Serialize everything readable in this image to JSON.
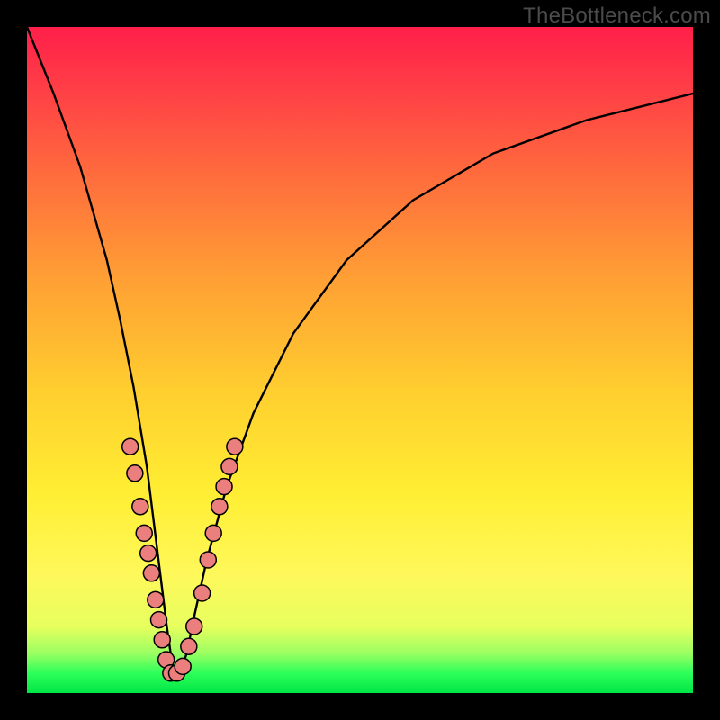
{
  "watermark": "TheBottleneck.com",
  "colors": {
    "frame": "#000000",
    "curve_stroke": "#000000",
    "marker_fill": "#eb7f7d",
    "marker_stroke": "#000000",
    "gradient_top": "#ff1f4a",
    "gradient_mid": "#ffee33",
    "gradient_bottom": "#00e646"
  },
  "chart_data": {
    "type": "line",
    "title": "",
    "xlabel": "",
    "ylabel": "",
    "xlim": [
      0,
      100
    ],
    "ylim": [
      0,
      100
    ],
    "grid": false,
    "legend": false,
    "note": "Axes are unlabeled; values are pixel-proportional estimates on a 0–100 scale in each direction (0,0 at bottom-left). Curve forms a V reaching ~0 near x≈22.",
    "series": [
      {
        "name": "bottleneck-curve",
        "x": [
          0,
          4,
          8,
          12,
          14,
          16,
          18,
          19,
          20,
          21,
          22,
          23,
          24,
          25,
          27,
          30,
          34,
          40,
          48,
          58,
          70,
          84,
          100
        ],
        "y": [
          100,
          90,
          79,
          65,
          56,
          46,
          34,
          26,
          18,
          10,
          3,
          3,
          6,
          11,
          20,
          31,
          42,
          54,
          65,
          74,
          81,
          86,
          90
        ]
      }
    ],
    "markers": {
      "name": "curve-markers",
      "note": "Pink circular markers clustered on both walls of the V near the bottom.",
      "points": [
        {
          "x": 15.5,
          "y": 37
        },
        {
          "x": 16.2,
          "y": 33
        },
        {
          "x": 17.0,
          "y": 28
        },
        {
          "x": 17.6,
          "y": 24
        },
        {
          "x": 18.2,
          "y": 21
        },
        {
          "x": 18.7,
          "y": 18
        },
        {
          "x": 19.3,
          "y": 14
        },
        {
          "x": 19.8,
          "y": 11
        },
        {
          "x": 20.3,
          "y": 8
        },
        {
          "x": 20.9,
          "y": 5
        },
        {
          "x": 21.6,
          "y": 3
        },
        {
          "x": 22.5,
          "y": 3
        },
        {
          "x": 23.4,
          "y": 4
        },
        {
          "x": 24.3,
          "y": 7
        },
        {
          "x": 25.1,
          "y": 10
        },
        {
          "x": 26.3,
          "y": 15
        },
        {
          "x": 27.2,
          "y": 20
        },
        {
          "x": 28.0,
          "y": 24
        },
        {
          "x": 28.9,
          "y": 28
        },
        {
          "x": 29.6,
          "y": 31
        },
        {
          "x": 30.4,
          "y": 34
        },
        {
          "x": 31.2,
          "y": 37
        }
      ]
    }
  }
}
